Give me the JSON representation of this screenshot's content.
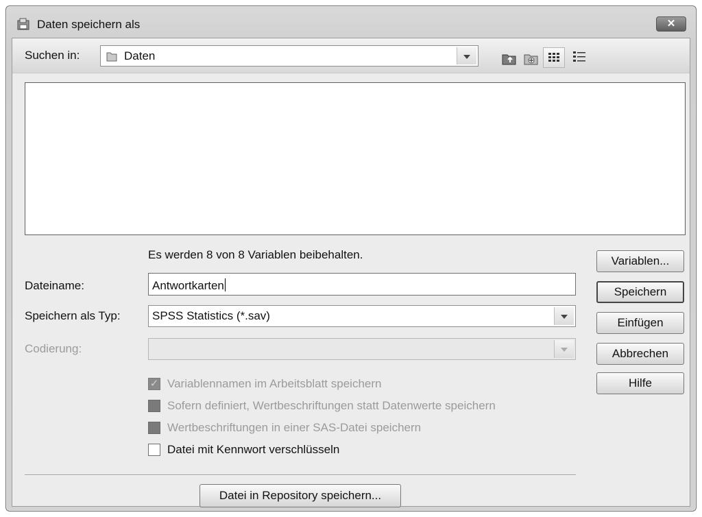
{
  "title": "Daten speichern als",
  "icons": {
    "app": "save-dialog-icon",
    "close": "close-icon",
    "folder": "folder-icon",
    "up": "up-folder-icon",
    "new_folder": "new-folder-icon",
    "list_view": "list-view-icon",
    "details_view": "details-view-icon"
  },
  "close_label": "✕",
  "look_in": {
    "label": "Suchen in:",
    "value": "Daten"
  },
  "info": "Es werden 8 von 8 Variablen beibehalten.",
  "filename": {
    "label": "Dateiname:",
    "value": "Antwortkarten"
  },
  "save_type": {
    "label": "Speichern als Typ:",
    "value": "SPSS Statistics (*.sav)"
  },
  "encoding": {
    "label": "Codierung:",
    "value": ""
  },
  "options": [
    {
      "label": "Variablennamen im Arbeitsblatt speichern",
      "checked": true,
      "enabled": false
    },
    {
      "label": "Sofern definiert, Wertbeschriftungen statt Datenwerte speichern",
      "checked": false,
      "enabled": false
    },
    {
      "label": "Wertbeschriftungen in einer SAS-Datei speichern",
      "checked": false,
      "enabled": false
    },
    {
      "label": "Datei mit Kennwort verschlüsseln",
      "checked": false,
      "enabled": true
    }
  ],
  "buttons": {
    "variables": "Variablen...",
    "save": "Speichern",
    "paste": "Einfügen",
    "cancel": "Abbrechen",
    "help": "Hilfe",
    "repository": "Datei in Repository speichern..."
  }
}
